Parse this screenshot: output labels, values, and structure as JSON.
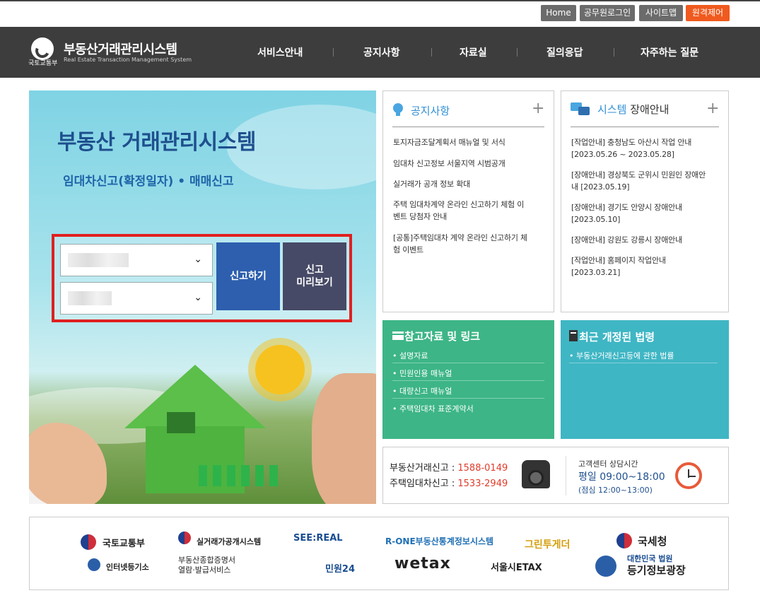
{
  "utility_links": [
    {
      "label": "Home"
    },
    {
      "label": "공무원로그인"
    },
    {
      "label": "사이트맵"
    },
    {
      "label": "원격제어"
    }
  ],
  "header": {
    "ministry": "국토교통부",
    "title": "부동산거래관리시스템",
    "subtitle": "Real Estate Transaction Management System",
    "nav": [
      "서비스안내",
      "공지사항",
      "자료실",
      "질의응답",
      "자주하는 질문"
    ]
  },
  "hero": {
    "title": "부동산 거래관리시스템",
    "subtitle": "임대차신고(확정일자) • 매매신고",
    "report_button": "신고하기",
    "preview_button_line1": "신고",
    "preview_button_line2": "미리보기"
  },
  "notice_panel": {
    "title": "공지사항",
    "items": [
      "토지자금조달계획서 매뉴얼 및 서식",
      "임대차 신고정보 서울지역 시범공개",
      "실거래가 공개 정보 확대",
      "주택 임대차계약 온라인 신고하기 체험 이",
      "벤트 당첨자 안내",
      "[공통]주택임대차 계약 온라인 신고하기 체",
      "험 이벤트"
    ]
  },
  "outage_panel": {
    "title_accent": "시스템",
    "title_rest": "장애안내",
    "items": [
      "[작업안내] 충청남도 아산시 작업 안내",
      "[2023.05.26 ~ 2023.05.28]",
      "[장애안내] 경상북도 군위시 민원인 장애안",
      "내 [2023.05.19]",
      "[장애안내] 경기도 안양시 장애안내",
      "[2023.05.10]",
      "[장애안내] 강원도 강릉시 장애안내",
      "[작업안내] 홈페이지 작업안내",
      "[2023.03.21]"
    ]
  },
  "reference_box": {
    "title": "참고자료 및 링크",
    "items": [
      "설명자료",
      "민원인용 매뉴얼",
      "대량신고 매뉴얼",
      "주택임대차 표준계약서"
    ]
  },
  "law_box": {
    "title": "최근 개정된 법령",
    "items": [
      "부동산거래신고등에 관한 법률"
    ]
  },
  "contact": {
    "trade_label": "부동산거래신고 : ",
    "trade_number": "1588-0149",
    "lease_label": "주택임대차신고 : ",
    "lease_number": "1533-2949",
    "cs_title": "고객센터 상담시간",
    "cs_hours": "평일 09:00~18:00",
    "cs_lunch": "(점심 12:00~13:00)"
  },
  "footer_links": {
    "molit": "국토교통부",
    "realprice": "실거래가공개시스템",
    "seereal": "SEE:REAL",
    "rone": "R-ONE부동산통계정보시스템",
    "greentogether": "그린투게더",
    "nts": "국세청",
    "iros": "인터넷등기소",
    "cert_line1": "부동산종합증명서",
    "cert_line2": "열람·발급서비스",
    "minwon": "민원24",
    "wetax": "wetax",
    "etax": "서울시ETAX",
    "court_line1": "대한민국 법원",
    "court_line2": "등기정보광장"
  }
}
